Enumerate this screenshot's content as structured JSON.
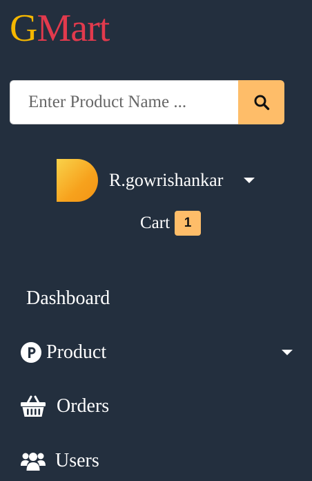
{
  "brand": {
    "first_letter": "G",
    "rest": "Mart",
    "colors": {
      "first_letter": "#f5b700",
      "rest": "#e23a4d"
    }
  },
  "search": {
    "placeholder": "Enter Product Name ...",
    "value": "",
    "button_icon": "search-icon"
  },
  "user": {
    "name": "R.gowrishankar",
    "avatar": "avatar-image"
  },
  "cart": {
    "label": "Cart",
    "count": "1"
  },
  "nav": {
    "dashboard": {
      "label": "Dashboard"
    },
    "product": {
      "label": "Product",
      "icon": "product-p-icon"
    },
    "orders": {
      "label": "Orders",
      "icon": "basket-icon"
    },
    "users": {
      "label": "Users",
      "icon": "users-icon"
    }
  },
  "colors": {
    "background": "#232f3e",
    "accent": "#febd69",
    "text": "#ffffff"
  }
}
